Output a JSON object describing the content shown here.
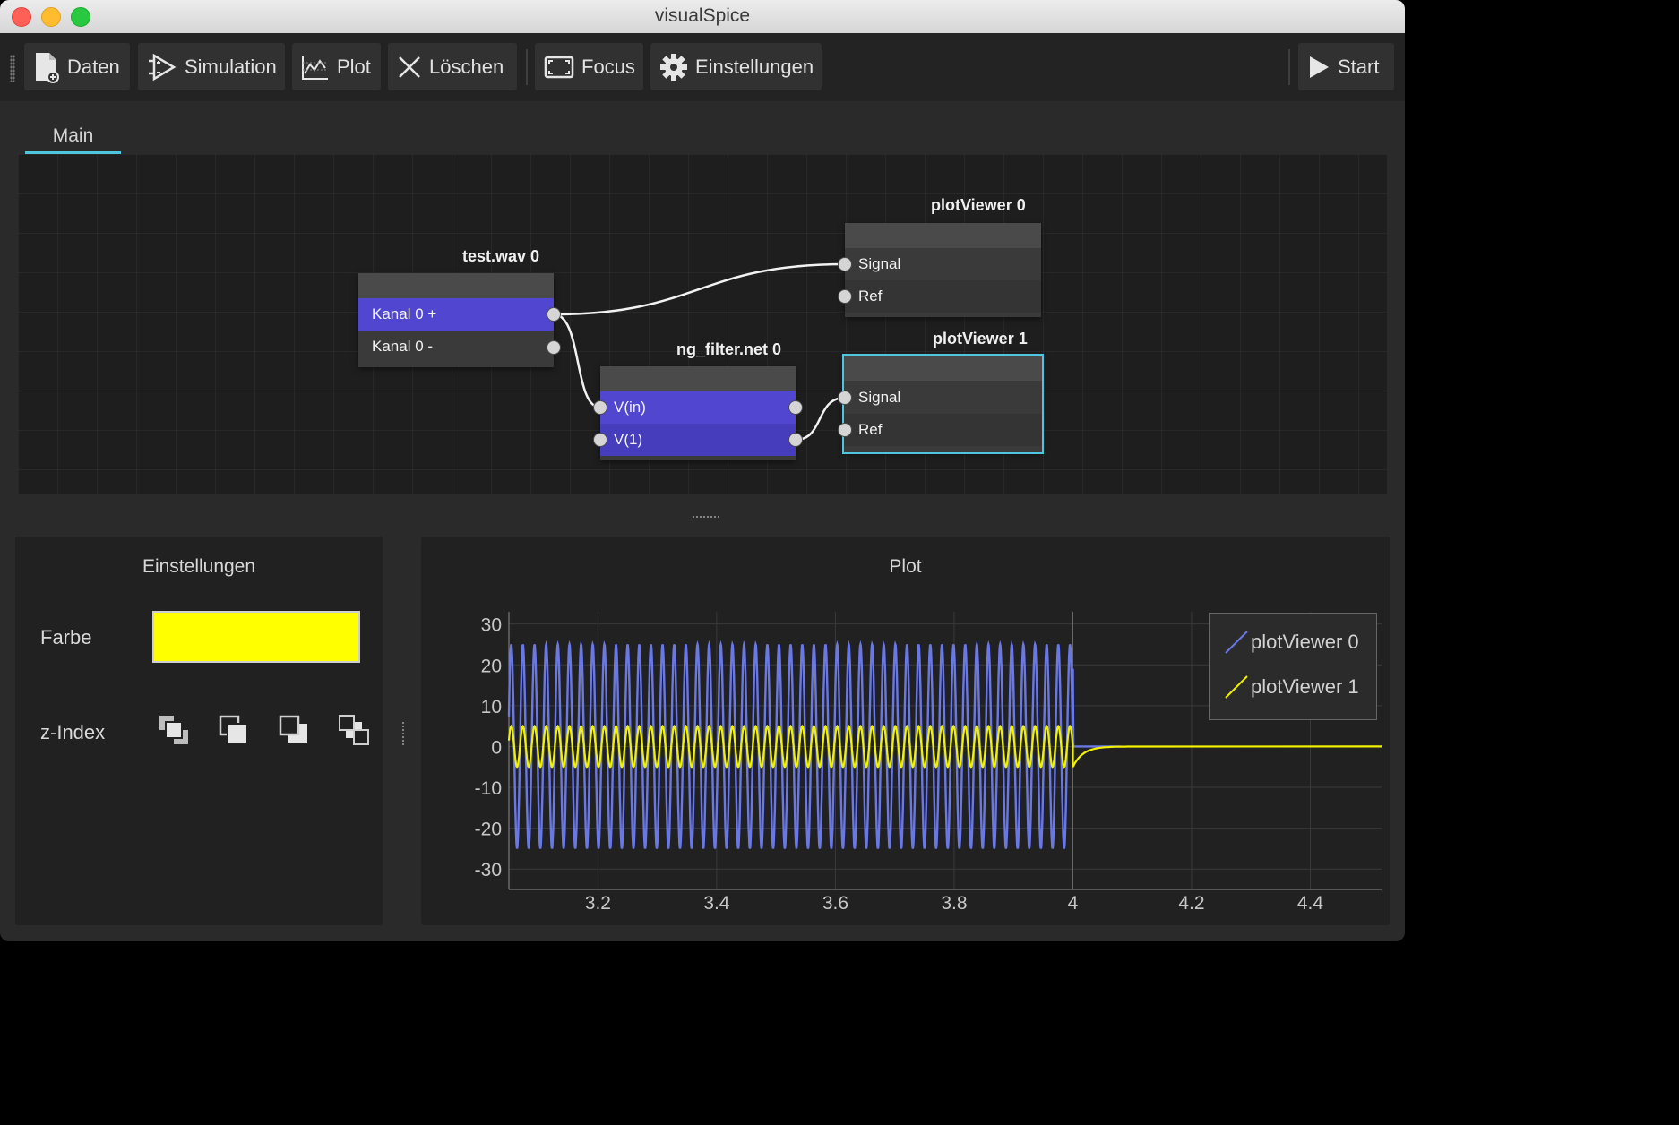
{
  "window": {
    "title": "visualSpice"
  },
  "toolbar": {
    "buttons": [
      {
        "label": "Daten",
        "icon": "document-add-icon"
      },
      {
        "label": "Simulation",
        "icon": "amplifier-icon"
      },
      {
        "label": "Plot",
        "icon": "line-chart-icon"
      },
      {
        "label": "Löschen",
        "icon": "close-x-icon"
      },
      {
        "label": "Focus",
        "icon": "focus-frame-icon"
      },
      {
        "label": "Einstellungen",
        "icon": "gear-icon"
      },
      {
        "label": "Start",
        "icon": "play-icon"
      }
    ]
  },
  "tabs": [
    {
      "label": "Main",
      "active": true
    }
  ],
  "graph": {
    "nodes": [
      {
        "title": "test.wav 0",
        "ports": [
          {
            "label": "Kanal 0 +"
          },
          {
            "label": "Kanal 0 -"
          }
        ]
      },
      {
        "title": "ng_filter.net 0",
        "ports": [
          {
            "label": "V(in)"
          },
          {
            "label": "V(1)"
          }
        ]
      },
      {
        "title": "plotViewer 0",
        "ports": [
          {
            "label": "Signal"
          },
          {
            "label": "Ref"
          }
        ]
      },
      {
        "title": "plotViewer 1",
        "ports": [
          {
            "label": "Signal"
          },
          {
            "label": "Ref"
          }
        ],
        "selected": true
      }
    ],
    "connections": [
      {
        "from": "test.wav 0 / Kanal 0 +",
        "to": "plotViewer 0 / Signal"
      },
      {
        "from": "test.wav 0 / Kanal 0 +",
        "to": "ng_filter.net 0 / V(in)"
      },
      {
        "from": "ng_filter.net 0 / V(1)",
        "to": "plotViewer 1 / Signal"
      }
    ]
  },
  "settings_panel": {
    "title": "Einstellungen",
    "color_label": "Farbe",
    "color_value": "#ffff00",
    "zindex_label": "z-Index",
    "zindex_buttons": [
      "bring-to-front-icon",
      "bring-forward-icon",
      "send-backward-icon",
      "send-to-back-icon"
    ]
  },
  "plot_panel": {
    "title": "Plot",
    "chart_data": {
      "type": "line",
      "title": "",
      "xlabel": "",
      "ylabel": "",
      "xlim": [
        3.05,
        4.52
      ],
      "ylim": [
        -35,
        33
      ],
      "x_ticks": [
        "3.2",
        "3.4",
        "3.6",
        "3.8",
        "4",
        "4.2",
        "4.4"
      ],
      "y_ticks": [
        "30",
        "20",
        "10",
        "0",
        "-10",
        "-20",
        "-30"
      ],
      "grid": true,
      "legend_position": "top-right",
      "series": [
        {
          "name": "plotViewer 0",
          "color": "#6a78e6",
          "shape": "sine",
          "amplitude": 25,
          "cycles_per_unit": 51,
          "ends_at_x": 4.0,
          "then": "spike to 19 at x=4.0, then 0"
        },
        {
          "name": "plotViewer 1",
          "color": "#f2f200",
          "shape": "sine",
          "amplitude": 5,
          "cycles_per_unit": 51,
          "ends_at_x": 4.0,
          "then": "dip to -5 at x=4.0, decays to 0 by x≈4.1, flat 0 afterwards"
        }
      ]
    }
  },
  "colors": {
    "accent": "#4fc6de",
    "port_active": "#5146cf",
    "series_blue": "#6a78e6",
    "series_yellow": "#f2f200"
  }
}
